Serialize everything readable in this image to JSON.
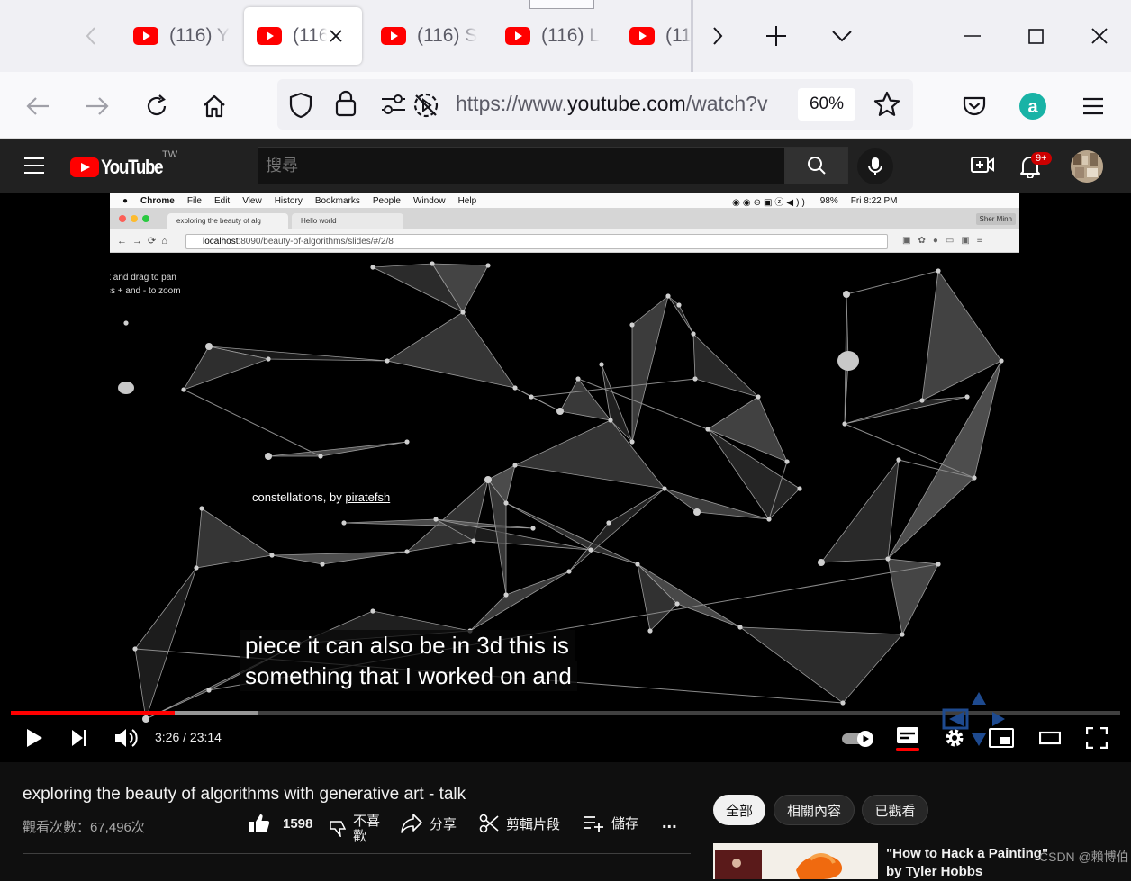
{
  "browser": {
    "tabs": [
      {
        "title": "(116) Y",
        "active": false
      },
      {
        "title": "(116",
        "active": true
      },
      {
        "title": "(116) S",
        "active": false
      },
      {
        "title": "(116) L",
        "active": false
      },
      {
        "title": "(11",
        "active": false
      }
    ],
    "url_prefix": "https://www.",
    "url_domain": "youtube.com",
    "url_suffix": "/watch?v",
    "zoom": "60%"
  },
  "youtube": {
    "logo_text": "YouTube",
    "region": "TW",
    "search_placeholder": "搜尋",
    "notification_count": "9+",
    "brand_color": "#ff0000"
  },
  "video_content": {
    "mac_menu": [
      "Chrome",
      "File",
      "Edit",
      "View",
      "History",
      "Bookmarks",
      "People",
      "Window",
      "Help"
    ],
    "mac_status": {
      "battery": "98%",
      "clock": "Fri 8:22 PM"
    },
    "chrome_tabs": [
      "exploring the beauty of alg",
      "Hello world"
    ],
    "chrome_user": "Sher Minn",
    "chrome_url_host": "localhost",
    "chrome_url_path": ":8090/beauty-of-algorithms/slides/#/2/8",
    "hint_line1": "k and drag to pan",
    "hint_line2": "ss + and - to zoom",
    "credit_prefix": "constellations, by ",
    "credit_author": "piratefsh",
    "caption_line1": "piece it can also be in 3d this is",
    "caption_line2": "something that I worked on and"
  },
  "player": {
    "current_time": "3:26",
    "duration": "23:14",
    "time_display": "3:26 / 23:14",
    "played_fraction": 0.148,
    "loaded_fraction": 0.222
  },
  "video": {
    "title": "exploring the beauty of algorithms with generative art - talk",
    "views": "觀看次數：67,496次",
    "likes": "1598",
    "dislike_label": "不喜歡",
    "share_label": "分享",
    "clip_label": "剪輯片段",
    "save_label": "儲存",
    "more_label": "..."
  },
  "sidebar": {
    "chips": [
      {
        "label": "全部",
        "active": true
      },
      {
        "label": "相關內容",
        "active": false
      },
      {
        "label": "已觀看",
        "active": false
      }
    ],
    "rec_title": "\"How to Hack a Painting\" by Tyler Hobbs"
  },
  "watermark": "CSDN @賴博伯"
}
